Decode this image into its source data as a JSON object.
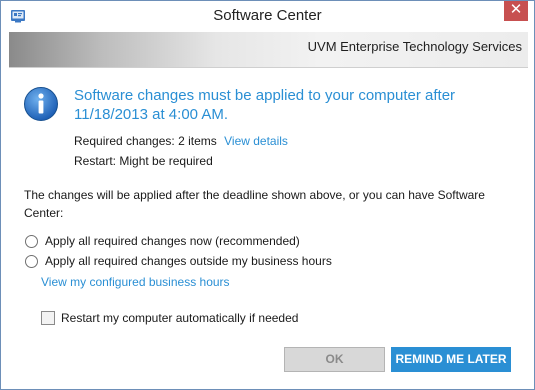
{
  "window": {
    "title": "Software Center",
    "close_glyph": "✕",
    "app_icon": "software-center-icon"
  },
  "banner": {
    "org_name": "UVM Enterprise Technology Services"
  },
  "notice": {
    "icon": "info-icon",
    "headline": "Software changes must be applied to your computer after 11/18/2013 at 4:00 AM.",
    "required_label": "Required changes:",
    "required_value": "2 items",
    "view_details_link": "View details",
    "restart_label": "Restart:",
    "restart_value": "Might be required"
  },
  "description": "The changes will be applied after the deadline shown above, or you can have Software Center:",
  "options": {
    "apply_now": "Apply all required changes now (recommended)",
    "apply_outside_hours": "Apply all required changes outside my business hours",
    "business_hours_link": "View my configured business hours",
    "restart_checkbox": "Restart my computer automatically if needed"
  },
  "buttons": {
    "ok": "OK",
    "remind_later": "REMIND ME LATER"
  },
  "colors": {
    "accent": "#2a8fd4",
    "close": "#c75050",
    "disabled_button": "#d8d8d8"
  }
}
